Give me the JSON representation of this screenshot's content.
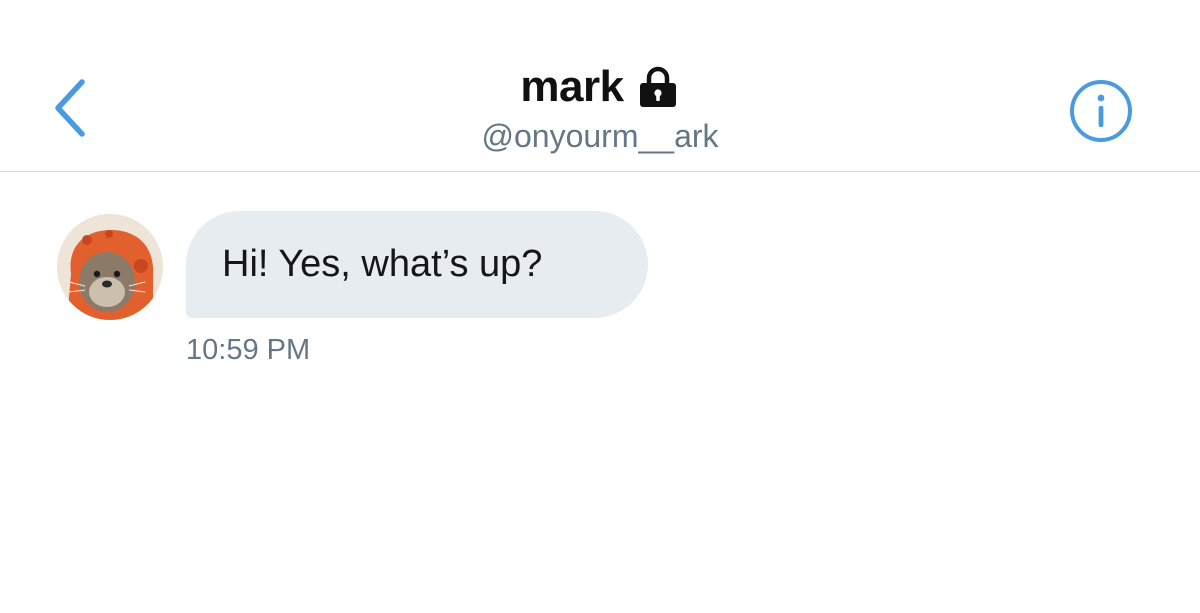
{
  "header": {
    "display_name": "mark",
    "handle": "@onyourm__ark",
    "back_icon": "chevron-left-icon",
    "lock_icon": "lock-icon",
    "info_icon": "info-icon"
  },
  "conversation": {
    "messages": [
      {
        "text": "Hi! Yes, what’s up?",
        "time": "10:59 PM"
      }
    ]
  },
  "colors": {
    "accent": "#4a9ae0",
    "bubble": "#e6ecf0",
    "secondary_text": "#657786",
    "primary_text": "#14171a"
  }
}
